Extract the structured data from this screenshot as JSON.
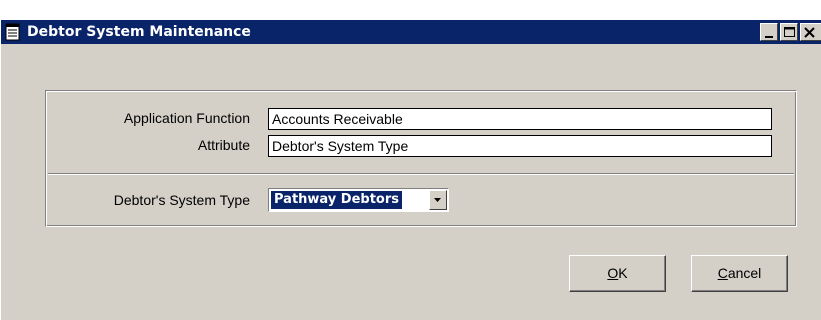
{
  "window": {
    "title": "Debtor System Maintenance",
    "icon": "document-icon"
  },
  "form": {
    "application_function_label": "Application Function",
    "application_function_value": "Accounts Receivable",
    "attribute_label": "Attribute",
    "attribute_value": "Debtor's System Type",
    "system_type_label": "Debtor's System Type",
    "system_type_value": "Pathway Debtors"
  },
  "buttons": {
    "ok_mnemonic": "O",
    "ok_rest": "K",
    "cancel_mnemonic": "C",
    "cancel_rest": "ancel"
  },
  "colors": {
    "titlebar": "#0a246a",
    "face": "#d4d0c8",
    "selection": "#0a246a"
  }
}
